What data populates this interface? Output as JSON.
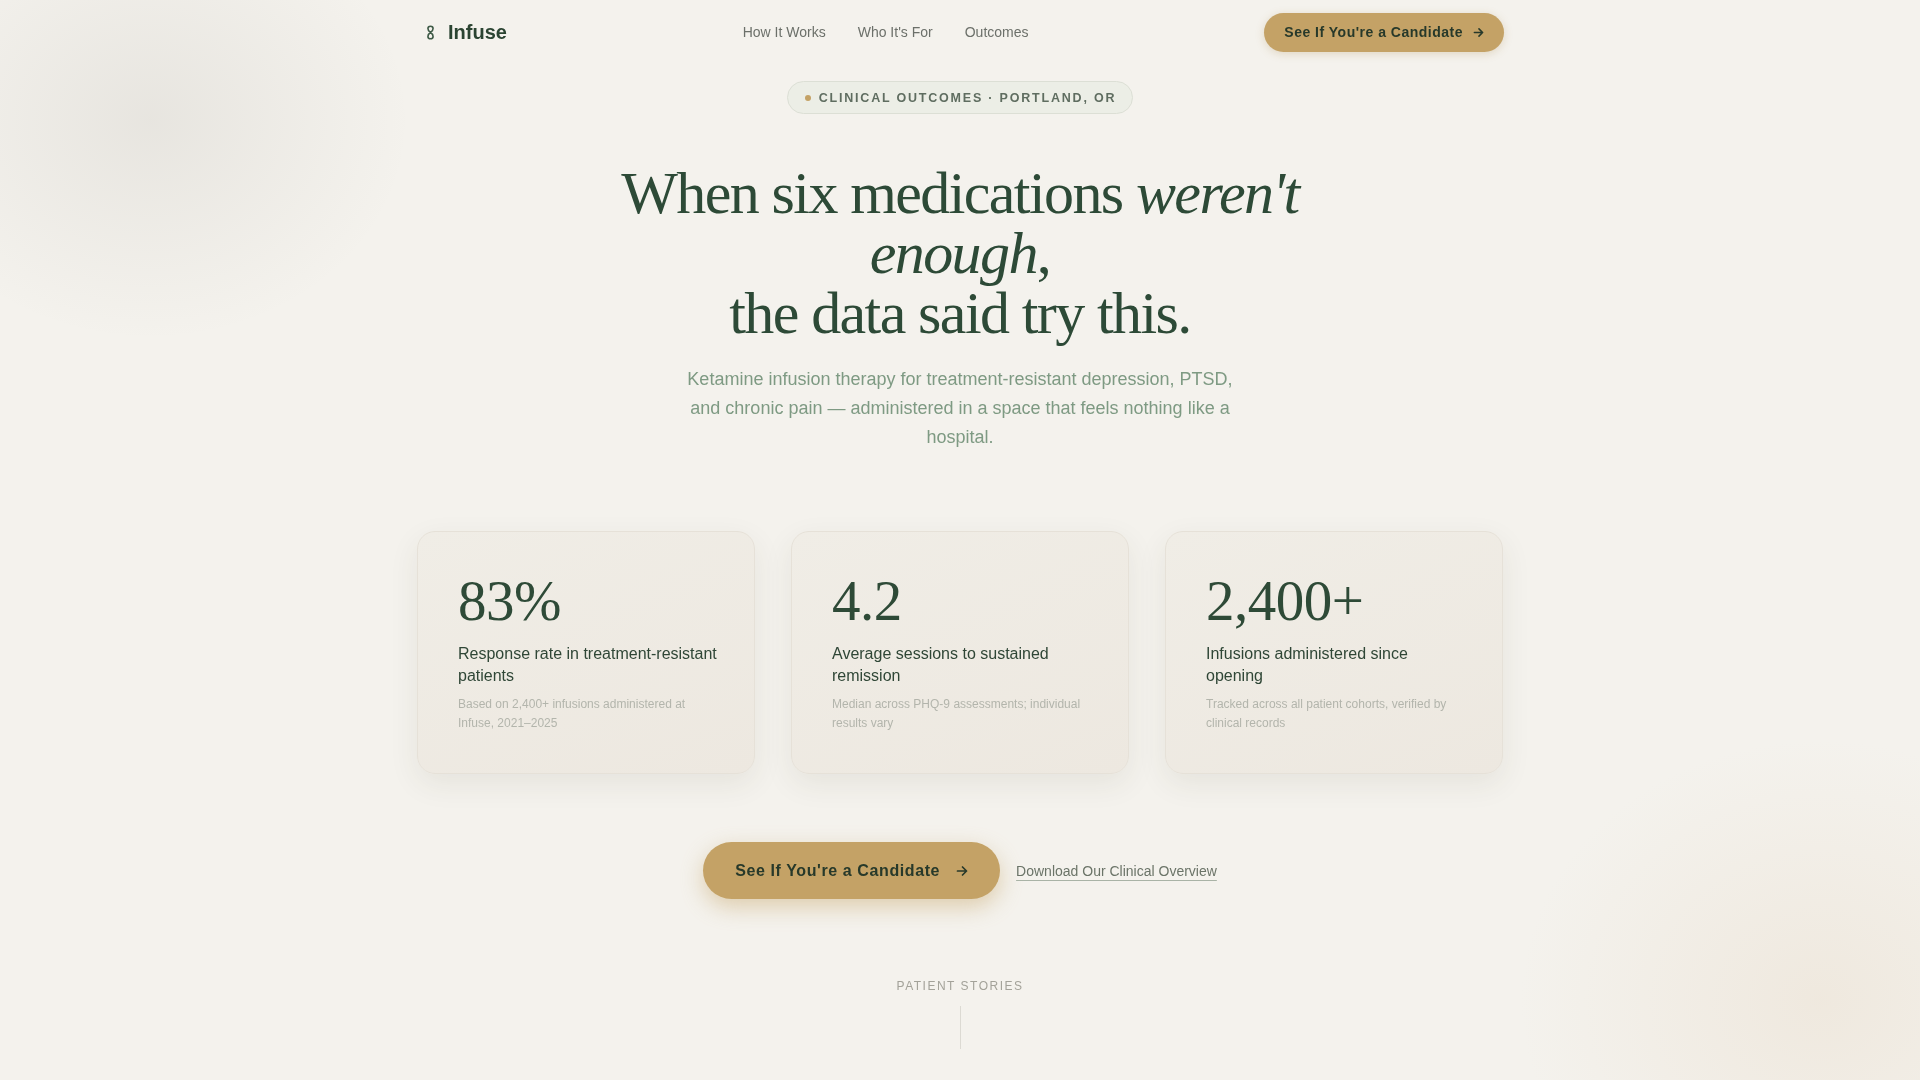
{
  "nav": {
    "brand": "Infuse",
    "links": [
      {
        "label": "How It Works"
      },
      {
        "label": "Who It's For"
      },
      {
        "label": "Outcomes"
      }
    ],
    "cta": "See If You're a Candidate"
  },
  "hero": {
    "eyebrow": "CLINICAL OUTCOMES · PORTLAND, OR",
    "heading_lines": [
      "When six medications *weren't enough*,",
      "the data said try this."
    ],
    "subtitle": "Ketamine infusion therapy for treatment-resistant depression, PTSD, and chronic pain — administered in a space that feels nothing like a hospital."
  },
  "stats": [
    {
      "value": "83%",
      "label": "Response rate in treatment-resistant patients",
      "note": "Based on 2,400+ infusions administered at Infuse, 2021–2025"
    },
    {
      "value": "4.2",
      "label": "Average sessions to sustained remission",
      "note": "Median across PHQ-9 assessments; individual results vary"
    },
    {
      "value": "2,400+",
      "label": "Infusions administered since opening",
      "note": "Tracked across all patient cohorts, verified by clinical records"
    }
  ],
  "cta": {
    "button": "See If You're a Candidate",
    "link": "Download Our Clinical Overview"
  },
  "section_label": "PATIENT STORIES"
}
